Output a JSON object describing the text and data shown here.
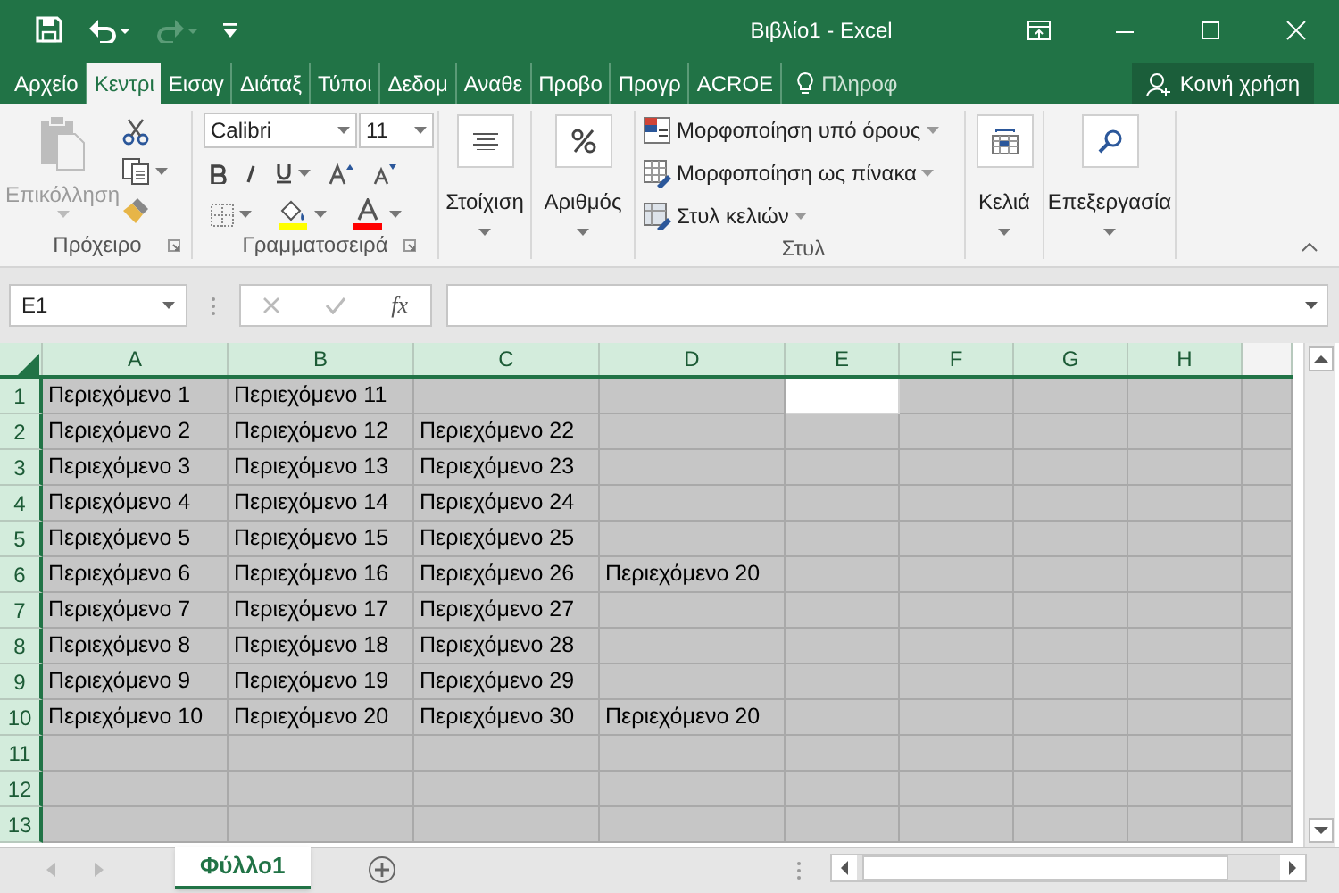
{
  "window": {
    "title": "Βιβλίο1 - Excel"
  },
  "quick_access": [
    {
      "kind": "save",
      "disabled": false
    },
    {
      "kind": "undo",
      "disabled": false
    },
    {
      "kind": "redo",
      "disabled": true
    },
    {
      "kind": "customize",
      "disabled": false
    }
  ],
  "tabs": [
    {
      "label": "Αρχείο",
      "selected": false
    },
    {
      "label": "Κεντρι",
      "selected": true
    },
    {
      "label": "Εισαγ",
      "selected": false
    },
    {
      "label": "Διάταξ",
      "selected": false
    },
    {
      "label": "Τύποι",
      "selected": false
    },
    {
      "label": "Δεδομ",
      "selected": false
    },
    {
      "label": "Αναθε",
      "selected": false
    },
    {
      "label": "Προβο",
      "selected": false
    },
    {
      "label": "Προγρ",
      "selected": false
    },
    {
      "label": "ACROE",
      "selected": false
    }
  ],
  "tell_me": {
    "label": "Πληροφ"
  },
  "share_button": {
    "label": "Κοινή χρήση"
  },
  "ribbon": {
    "clipboard": {
      "paste": {
        "label": "Επικόλληση",
        "disabled": true
      },
      "group_label": "Πρόχειρο"
    },
    "font": {
      "name": "Calibri",
      "size": "11",
      "group_label": "Γραμματοσειρά"
    },
    "alignment": {
      "label": "Στοίχιση"
    },
    "number": {
      "label": "Αριθμός"
    },
    "styles": {
      "items": [
        "Μορφοποίηση υπό όρους",
        "Μορφοποίηση ως πίνακα",
        "Στυλ κελιών"
      ],
      "group_label": "Στυλ"
    },
    "cells": {
      "label": "Κελιά"
    },
    "editing": {
      "label": "Επεξεργασία"
    }
  },
  "formula_bar": {
    "name_box": "E1",
    "function_label": "fx"
  },
  "grid": {
    "columns": [
      {
        "label": "A",
        "selected": true
      },
      {
        "label": "B",
        "selected": true
      },
      {
        "label": "C",
        "selected": true
      },
      {
        "label": "D",
        "selected": true
      },
      {
        "label": "E",
        "selected": true
      },
      {
        "label": "F",
        "selected": true
      },
      {
        "label": "G",
        "selected": true
      },
      {
        "label": "H",
        "selected": true
      }
    ],
    "rows": [
      {
        "header": "1",
        "selected": true,
        "cells": [
          {
            "text": "Περιεχόμενο 1",
            "selected": true
          },
          {
            "text": "Περιεχόμενο 11",
            "selected": true
          },
          {
            "selected": true
          },
          {
            "selected": true
          },
          {
            "selected": false
          },
          {
            "selected": true
          },
          {
            "selected": true
          },
          {
            "selected": true
          },
          {
            "selected": true
          }
        ]
      },
      {
        "header": "2",
        "selected": true,
        "cells": [
          {
            "text": "Περιεχόμενο 2",
            "selected": true
          },
          {
            "text": "Περιεχόμενο 12",
            "selected": true
          },
          {
            "text": "Περιεχόμενο 22",
            "selected": true
          },
          {
            "selected": true
          },
          {
            "selected": true
          },
          {
            "selected": true
          },
          {
            "selected": true
          },
          {
            "selected": true
          },
          {
            "selected": true
          }
        ]
      },
      {
        "header": "3",
        "selected": true,
        "cells": [
          {
            "text": "Περιεχόμενο 3",
            "selected": true
          },
          {
            "text": "Περιεχόμενο 13",
            "selected": true
          },
          {
            "text": "Περιεχόμενο 23",
            "selected": true
          },
          {
            "selected": true
          },
          {
            "selected": true
          },
          {
            "selected": true
          },
          {
            "selected": true
          },
          {
            "selected": true
          },
          {
            "selected": true
          }
        ]
      },
      {
        "header": "4",
        "selected": true,
        "cells": [
          {
            "text": "Περιεχόμενο 4",
            "selected": true
          },
          {
            "text": "Περιεχόμενο 14",
            "selected": true
          },
          {
            "text": "Περιεχόμενο 24",
            "selected": true
          },
          {
            "selected": true
          },
          {
            "selected": true
          },
          {
            "selected": true
          },
          {
            "selected": true
          },
          {
            "selected": true
          },
          {
            "selected": true
          }
        ]
      },
      {
        "header": "5",
        "selected": true,
        "cells": [
          {
            "text": "Περιεχόμενο 5",
            "selected": true
          },
          {
            "text": "Περιεχόμενο 15",
            "selected": true
          },
          {
            "text": "Περιεχόμενο 25",
            "selected": true
          },
          {
            "selected": true
          },
          {
            "selected": true
          },
          {
            "selected": true
          },
          {
            "selected": true
          },
          {
            "selected": true
          },
          {
            "selected": true
          }
        ]
      },
      {
        "header": "6",
        "selected": true,
        "cells": [
          {
            "text": "Περιεχόμενο 6",
            "selected": true
          },
          {
            "text": "Περιεχόμενο 16",
            "selected": true
          },
          {
            "text": "Περιεχόμενο 26",
            "selected": true
          },
          {
            "text": "Περιεχόμενο 20",
            "selected": true
          },
          {
            "selected": true
          },
          {
            "selected": true
          },
          {
            "selected": true
          },
          {
            "selected": true
          },
          {
            "selected": true
          }
        ]
      },
      {
        "header": "7",
        "selected": true,
        "cells": [
          {
            "text": "Περιεχόμενο 7",
            "selected": true
          },
          {
            "text": "Περιεχόμενο 17",
            "selected": true
          },
          {
            "text": "Περιεχόμενο 27",
            "selected": true
          },
          {
            "selected": true
          },
          {
            "selected": true
          },
          {
            "selected": true
          },
          {
            "selected": true
          },
          {
            "selected": true
          },
          {
            "selected": true
          }
        ]
      },
      {
        "header": "8",
        "selected": true,
        "cells": [
          {
            "text": "Περιεχόμενο 8",
            "selected": true
          },
          {
            "text": "Περιεχόμενο 18",
            "selected": true
          },
          {
            "text": "Περιεχόμενο 28",
            "selected": true
          },
          {
            "selected": true
          },
          {
            "selected": true
          },
          {
            "selected": true
          },
          {
            "selected": true
          },
          {
            "selected": true
          },
          {
            "selected": true
          }
        ]
      },
      {
        "header": "9",
        "selected": true,
        "cells": [
          {
            "text": "Περιεχόμενο 9",
            "selected": true
          },
          {
            "text": "Περιεχόμενο 19",
            "selected": true
          },
          {
            "text": "Περιεχόμενο 29",
            "selected": true
          },
          {
            "selected": true
          },
          {
            "selected": true
          },
          {
            "selected": true
          },
          {
            "selected": true
          },
          {
            "selected": true
          },
          {
            "selected": true
          }
        ]
      },
      {
        "header": "10",
        "selected": true,
        "cells": [
          {
            "text": "Περιεχόμενο 10",
            "selected": true
          },
          {
            "text": "Περιεχόμενο 20",
            "selected": true
          },
          {
            "text": "Περιεχόμενο 30",
            "selected": true
          },
          {
            "text": "Περιεχόμενο 20",
            "selected": true
          },
          {
            "selected": true
          },
          {
            "selected": true
          },
          {
            "selected": true
          },
          {
            "selected": true
          },
          {
            "selected": true
          }
        ]
      },
      {
        "header": "11",
        "selected": true,
        "cells": [
          {
            "selected": true
          },
          {
            "selected": true
          },
          {
            "selected": true
          },
          {
            "selected": true
          },
          {
            "selected": true
          },
          {
            "selected": true
          },
          {
            "selected": true
          },
          {
            "selected": true
          },
          {
            "selected": true
          }
        ]
      },
      {
        "header": "12",
        "selected": true,
        "cells": [
          {
            "selected": true
          },
          {
            "selected": true
          },
          {
            "selected": true
          },
          {
            "selected": true
          },
          {
            "selected": true
          },
          {
            "selected": true
          },
          {
            "selected": true
          },
          {
            "selected": true
          },
          {
            "selected": true
          }
        ]
      },
      {
        "header": "13",
        "selected": true,
        "cells": [
          {
            "selected": true
          },
          {
            "selected": true
          },
          {
            "selected": true
          },
          {
            "selected": true
          },
          {
            "selected": true
          },
          {
            "selected": true
          },
          {
            "selected": true
          },
          {
            "selected": true
          },
          {
            "selected": true
          }
        ]
      }
    ]
  },
  "sheet_tabs": [
    {
      "label": "Φύλλο1",
      "selected": true
    }
  ]
}
